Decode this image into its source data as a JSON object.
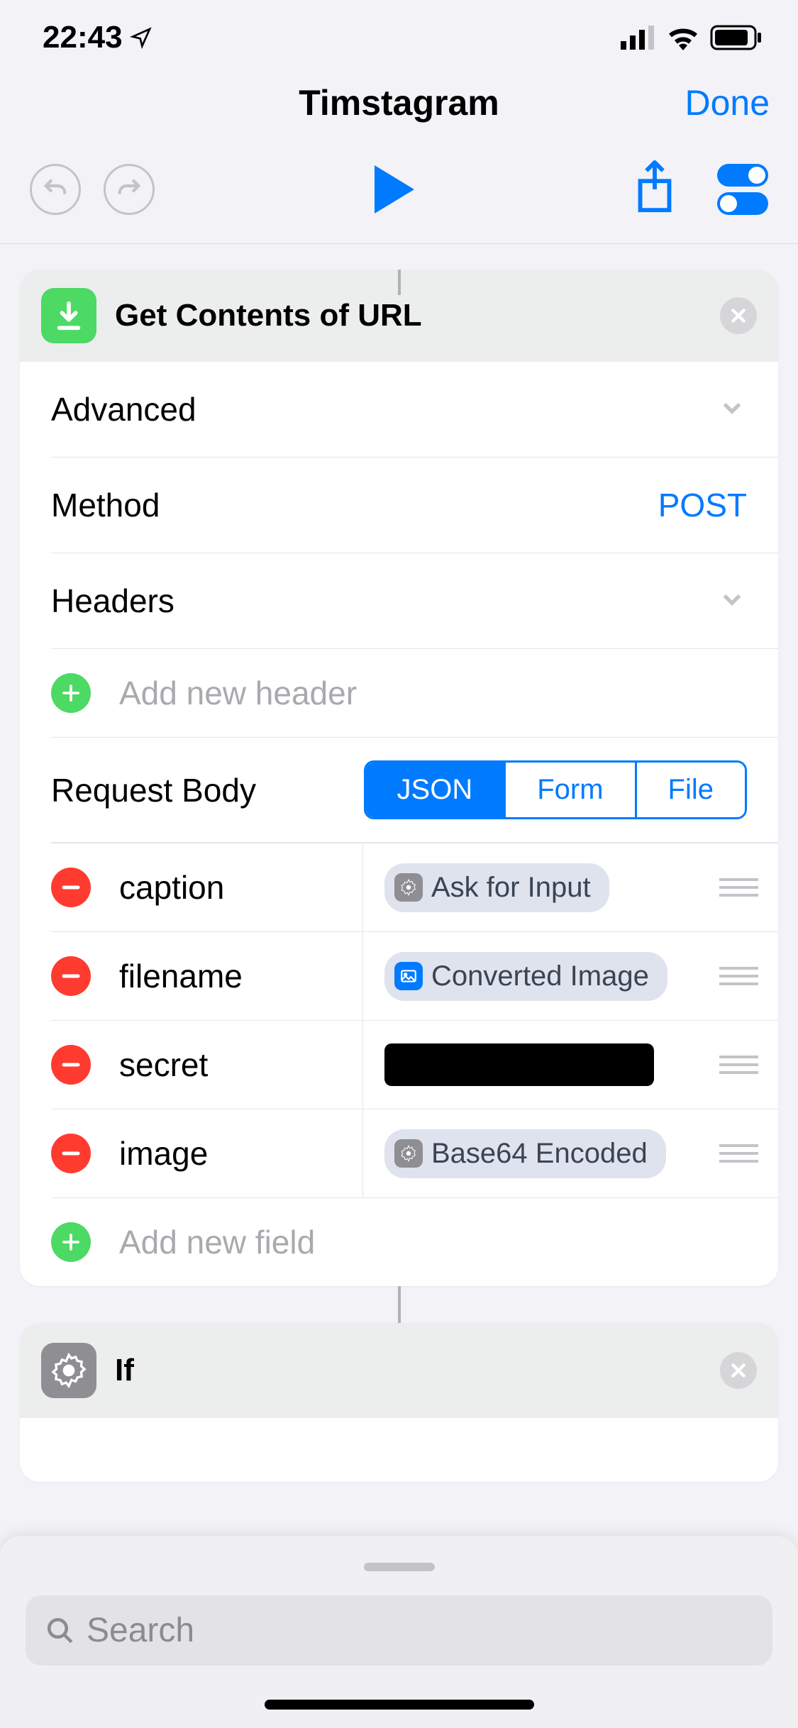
{
  "status_bar": {
    "time": "22:43"
  },
  "nav": {
    "title": "Timstagram",
    "done": "Done"
  },
  "action_card": {
    "title": "Get Contents of URL",
    "rows": {
      "advanced": "Advanced",
      "method_label": "Method",
      "method_value": "POST",
      "headers": "Headers"
    },
    "add_header_placeholder": "Add new header",
    "body_label": "Request Body",
    "segments": {
      "json": "JSON",
      "form": "Form",
      "file": "File"
    },
    "fields": {
      "caption": {
        "key": "caption",
        "pill": "Ask for Input"
      },
      "filename": {
        "key": "filename",
        "pill": "Converted Image"
      },
      "secret": {
        "key": "secret"
      },
      "image": {
        "key": "image",
        "pill": "Base64 Encoded"
      }
    },
    "add_field_placeholder": "Add new field"
  },
  "if_card": {
    "title": "If"
  },
  "search": {
    "placeholder": "Search"
  }
}
